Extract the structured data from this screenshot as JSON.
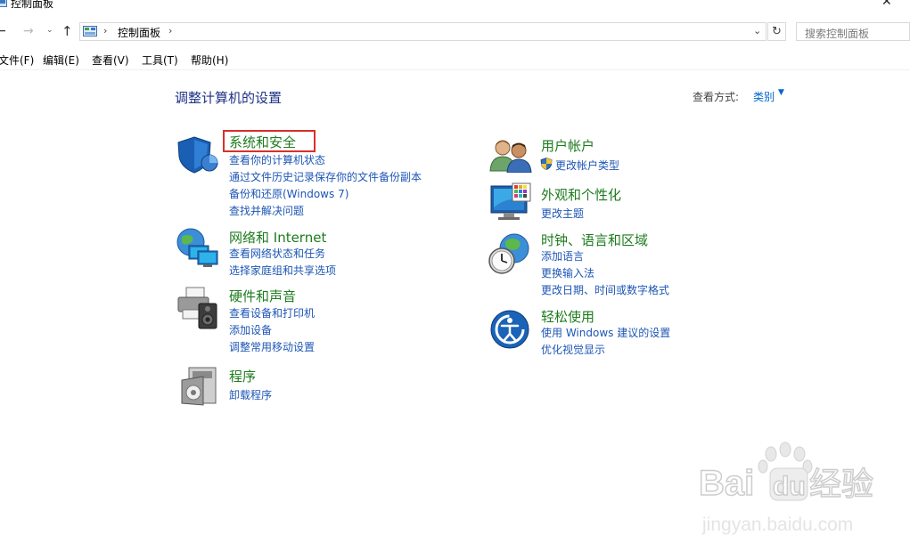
{
  "window": {
    "title": "控制面板",
    "close_glyph": "✕"
  },
  "nav": {
    "back_glyph": "←",
    "forward_glyph": "→",
    "recent_glyph": "⌄",
    "up_glyph": "↑",
    "address_separator": "›",
    "breadcrumb": "控制面板",
    "dropdown_glyph": "⌄",
    "refresh_glyph": "↻",
    "search_placeholder": "搜索控制面板"
  },
  "menu": [
    "文件(F)",
    "编辑(E)",
    "查看(V)",
    "工具(T)",
    "帮助(H)"
  ],
  "main": {
    "title": "调整计算机的设置",
    "view_by_label": "查看方式:",
    "view_by_value": "类别",
    "view_by_arrow": "▼"
  },
  "categories": [
    {
      "title": "系统和安全",
      "icon": "security-shield-icon",
      "links": [
        "查看你的计算机状态",
        "通过文件历史记录保存你的文件备份副本",
        "备份和还原(Windows 7)",
        "查找并解决问题"
      ]
    },
    {
      "title": "网络和 Internet",
      "icon": "network-globe-icon",
      "links": [
        "查看网络状态和任务",
        "选择家庭组和共享选项"
      ]
    },
    {
      "title": "硬件和声音",
      "icon": "printer-speaker-icon",
      "links": [
        "查看设备和打印机",
        "添加设备",
        "调整常用移动设置"
      ]
    },
    {
      "title": "程序",
      "icon": "programs-disc-icon",
      "links": [
        "卸载程序"
      ]
    },
    {
      "title": "用户帐户",
      "icon": "users-icon",
      "links": [
        "更改帐户类型"
      ]
    },
    {
      "title": "外观和个性化",
      "icon": "monitor-palette-icon",
      "links": [
        "更改主题"
      ]
    },
    {
      "title": "时钟、语言和区域",
      "icon": "clock-globe-icon",
      "links": [
        "添加语言",
        "更换输入法",
        "更改日期、时间或数字格式"
      ]
    },
    {
      "title": "轻松使用",
      "icon": "ease-of-access-icon",
      "links": [
        "使用 Windows 建议的设置",
        "优化视觉显示"
      ]
    }
  ],
  "watermark": {
    "brand": "Bai",
    "brand2": "du",
    "brand_cn": "经验",
    "url": "jingyan.baidu.com"
  },
  "colors": {
    "category_title": "#1e7b1e",
    "link": "#1d56b5",
    "page_title": "#1e3287",
    "highlight": "#d9302a"
  }
}
